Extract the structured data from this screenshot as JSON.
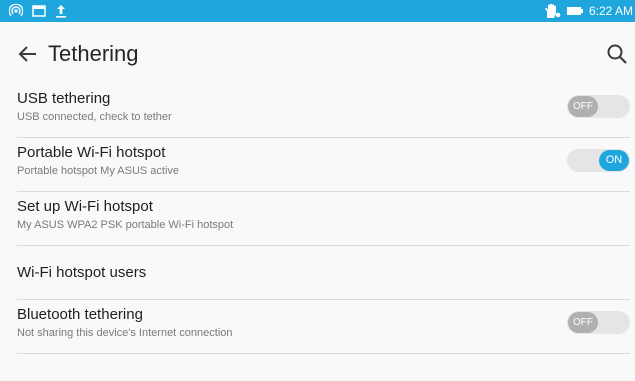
{
  "status_bar": {
    "time": "6:22 AM",
    "left_icons": [
      "hotspot-icon",
      "image-icon",
      "upload-icon"
    ],
    "right_icons": [
      "touch-icon",
      "battery-icon"
    ],
    "color": "#1fa7dd"
  },
  "header": {
    "title": "Tethering"
  },
  "settings": [
    {
      "title": "USB tethering",
      "subtitle": "USB connected, check to tether",
      "toggle": "OFF"
    },
    {
      "title": "Portable Wi-Fi hotspot",
      "subtitle": "Portable hotspot My ASUS active",
      "toggle": "ON"
    },
    {
      "title": "Set up Wi-Fi hotspot",
      "subtitle": "My ASUS WPA2 PSK portable Wi-Fi hotspot"
    },
    {
      "title": "Wi-Fi hotspot users"
    },
    {
      "title": "Bluetooth tethering",
      "subtitle": "Not sharing this device's Internet connection",
      "toggle": "OFF"
    }
  ]
}
